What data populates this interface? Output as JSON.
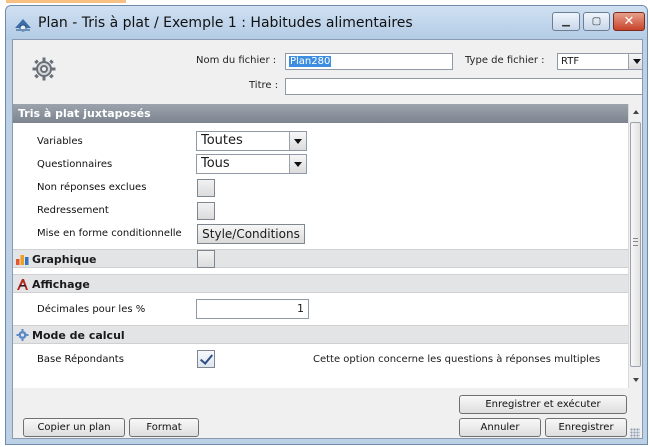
{
  "window": {
    "title": "Plan - Tris à plat / Exemple 1 : Habitudes alimentaires",
    "min_label": "▁",
    "max_label": "▢",
    "close_label": "✕"
  },
  "header": {
    "filename_label": "Nom du fichier :",
    "filename_value": "Plan280",
    "filetype_label": "Type de fichier :",
    "filetype_value": "RTF",
    "title_label": "Titre :",
    "title_value": ""
  },
  "sections": {
    "tris": {
      "title": "Tris à plat juxtaposés",
      "variables_label": "Variables",
      "variables_value": "Toutes",
      "questionnaires_label": "Questionnaires",
      "questionnaires_value": "Tous",
      "non_reponses_label": "Non réponses exclues",
      "non_reponses_checked": false,
      "redressement_label": "Redressement",
      "redressement_checked": false,
      "mise_en_forme_label": "Mise en forme conditionnelle",
      "style_button_label": "Style/Conditions"
    },
    "graphique": {
      "title": "Graphique",
      "checked": false
    },
    "affichage": {
      "title": "Affichage",
      "decimales_label": "Décimales pour les %",
      "decimales_value": "1"
    },
    "mode_calcul": {
      "title": "Mode de calcul",
      "base_label": "Base Répondants",
      "base_checked": true,
      "note": "Cette option concerne les questions à réponses multiples"
    }
  },
  "footer": {
    "copy_label": "Copier un plan",
    "format_label": "Format",
    "save_exec_label": "Enregistrer et exécuter",
    "cancel_label": "Annuler",
    "save_label": "Enregistrer"
  },
  "colors": {
    "accent_orange": "#f08a1c",
    "titlebar": "#bcd0e6",
    "section_header": "#8a919b"
  }
}
